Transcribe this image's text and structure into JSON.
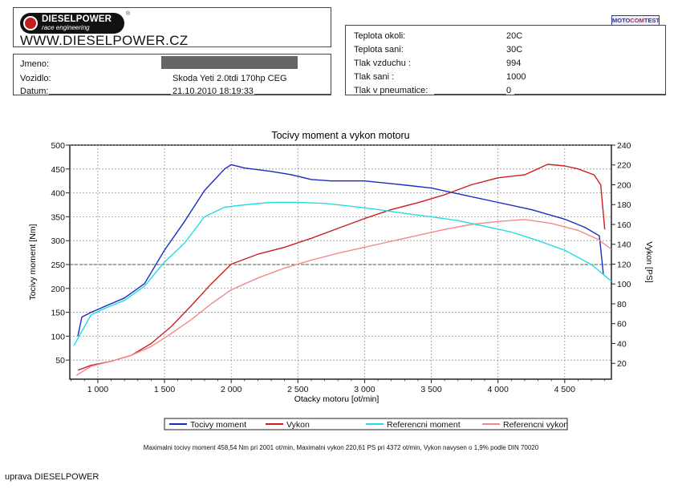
{
  "header": {
    "brand": "DIESELPOWER",
    "brand_sub": "race engineering",
    "registered": "®",
    "website": "WWW.DIESELPOWER.CZ",
    "test_logo_a": "MOTO",
    "test_logo_b": "COM",
    "test_logo_c": "TEST"
  },
  "vehicle": {
    "name_label": "Jmeno:",
    "vehicle_label": "Vozidlo:",
    "vehicle_value": "Skoda Yeti 2.0tdi 170hp CEG",
    "date_label": "Datum:",
    "date_value": "21.10.2010 18:19:33"
  },
  "conditions": [
    {
      "label": "Teplota okoli:",
      "value": "20C"
    },
    {
      "label": "Teplota sani:",
      "value": "30C"
    },
    {
      "label": "Tlak vzduchu :",
      "value": "994"
    },
    {
      "label": "Tlak sani :",
      "value": "1000"
    },
    {
      "label": "Tlak v pneumatice:",
      "value": "0"
    }
  ],
  "chart_data": {
    "type": "line",
    "title": "Tocivy moment a vykon motoru",
    "xlabel": "Otacky motoru [ot/min]",
    "ylabel": "Tocivy moment [Nm]",
    "y2label": "Vykon [PS]",
    "xlim": [
      790,
      4850
    ],
    "ylim": [
      10,
      500
    ],
    "y2lim": [
      4,
      240
    ],
    "grid": true,
    "legend": "bottom",
    "x_ticks": [
      1000,
      1500,
      2000,
      2500,
      3000,
      3500,
      4000,
      4500
    ],
    "x_tick_labels": [
      "1 000",
      "1 500",
      "2 000",
      "2 500",
      "3 000",
      "3 500",
      "4 000",
      "4 500"
    ],
    "y_ticks": [
      50,
      100,
      150,
      200,
      250,
      300,
      350,
      400,
      450,
      500
    ],
    "y2_ticks": [
      20,
      40,
      60,
      80,
      100,
      120,
      140,
      160,
      180,
      200,
      220,
      240
    ],
    "series": [
      {
        "name": "Tocivy moment",
        "axis": "left",
        "color": "#1a2bc0",
        "x": [
          850,
          880,
          950,
          1050,
          1200,
          1350,
          1500,
          1650,
          1800,
          1950,
          2001,
          2100,
          2300,
          2450,
          2600,
          2750,
          3000,
          3250,
          3500,
          3750,
          4000,
          4250,
          4500,
          4650,
          4760,
          4790
        ],
        "y": [
          100,
          140,
          150,
          162,
          180,
          210,
          280,
          340,
          405,
          450,
          459,
          452,
          445,
          438,
          428,
          425,
          425,
          418,
          410,
          395,
          380,
          365,
          345,
          328,
          310,
          230
        ]
      },
      {
        "name": "Vykon",
        "axis": "right",
        "color": "#cc1e1e",
        "x": [
          850,
          950,
          1100,
          1250,
          1400,
          1550,
          1700,
          1850,
          2000,
          2200,
          2400,
          2600,
          2800,
          3000,
          3200,
          3400,
          3600,
          3800,
          4000,
          4200,
          4372,
          4500,
          4600,
          4720,
          4770,
          4800
        ],
        "y": [
          13,
          18,
          22,
          28,
          40,
          57,
          78,
          100,
          120,
          130,
          137,
          146,
          156,
          166,
          175,
          182,
          190,
          200,
          207,
          210,
          220.61,
          219,
          216,
          210,
          200,
          155
        ]
      },
      {
        "name": "Referencni moment",
        "axis": "left",
        "color": "#22dde0",
        "x": [
          820,
          860,
          950,
          1050,
          1200,
          1350,
          1500,
          1650,
          1800,
          1950,
          2100,
          2300,
          2500,
          2700,
          2900,
          3100,
          3300,
          3500,
          3700,
          3900,
          4100,
          4300,
          4500,
          4700,
          4850
        ],
        "y": [
          80,
          100,
          145,
          158,
          175,
          205,
          255,
          295,
          350,
          370,
          375,
          380,
          380,
          378,
          372,
          365,
          357,
          350,
          342,
          330,
          318,
          300,
          280,
          250,
          215
        ]
      },
      {
        "name": "Referencni vykon",
        "axis": "right",
        "color": "#f08a8a",
        "x": [
          840,
          950,
          1100,
          1250,
          1400,
          1550,
          1700,
          1850,
          2000,
          2200,
          2400,
          2600,
          2800,
          3000,
          3200,
          3400,
          3600,
          3800,
          4000,
          4200,
          4400,
          4600,
          4750,
          4850
        ],
        "y": [
          8,
          17,
          22,
          28,
          37,
          50,
          64,
          80,
          94,
          106,
          116,
          124,
          131,
          137,
          143,
          149,
          155,
          160,
          163,
          165,
          161,
          154,
          145,
          135
        ]
      }
    ]
  },
  "footnote": "Maximalni tocivy moment 458,54 Nm pri 2001 ot/min,  Maximalni vykon 220,61 PS pri 4372 ot/min,  Vykon navysen o 1,9% podle DIN 70020",
  "bottom_note": "uprava DIESELPOWER"
}
